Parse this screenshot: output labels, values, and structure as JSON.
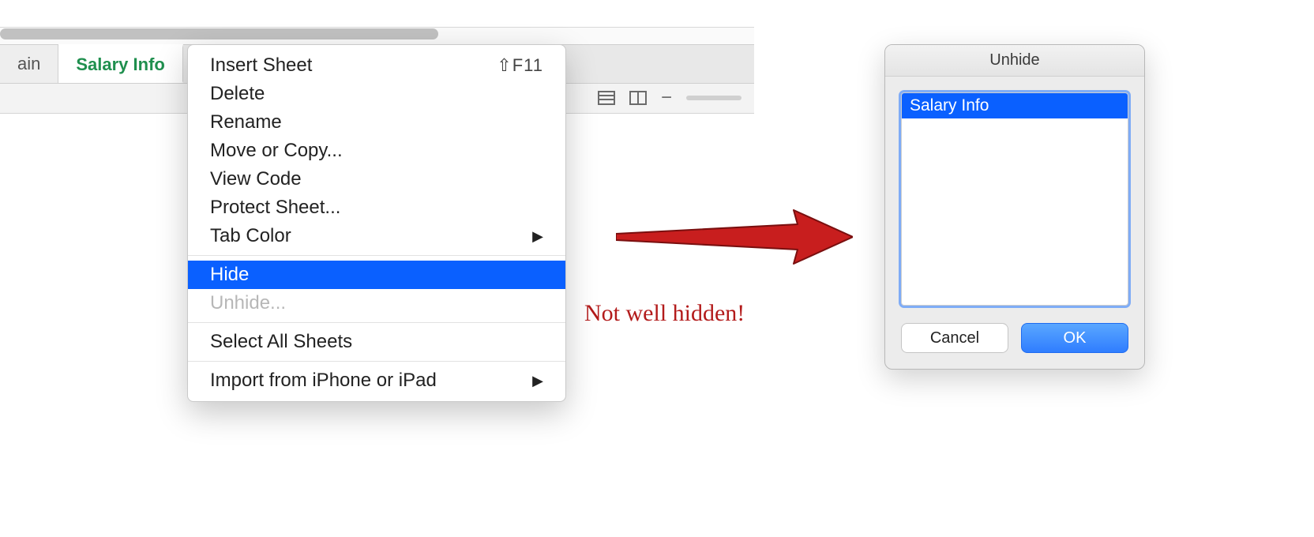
{
  "tabs": {
    "partial": "ain",
    "active": "Salary Info"
  },
  "context_menu": {
    "insert_sheet": "Insert Sheet",
    "insert_shortcut": "⇧F11",
    "delete": "Delete",
    "rename": "Rename",
    "move_or_copy": "Move or Copy...",
    "view_code": "View Code",
    "protect_sheet": "Protect Sheet...",
    "tab_color": "Tab Color",
    "hide": "Hide",
    "unhide": "Unhide...",
    "select_all": "Select All Sheets",
    "import_device": "Import from iPhone or iPad"
  },
  "annotation": {
    "caption": "Not well hidden!"
  },
  "dialog": {
    "title": "Unhide",
    "list": [
      "Salary Info"
    ],
    "cancel": "Cancel",
    "ok": "OK"
  }
}
